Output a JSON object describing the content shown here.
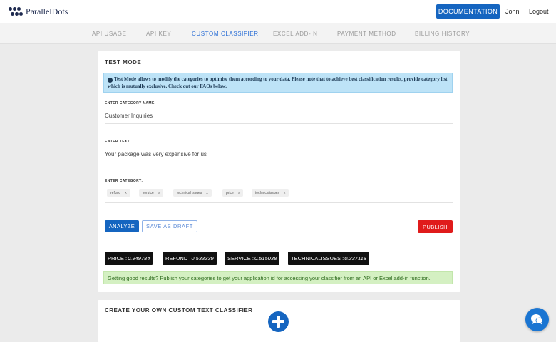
{
  "header": {
    "brand": "ParallelDots",
    "documentation_label": "DOCUMENTATION",
    "user": "John",
    "logout_label": "Logout"
  },
  "tabs": [
    {
      "label": "API USAGE",
      "active": false
    },
    {
      "label": "API KEY",
      "active": false
    },
    {
      "label": "CUSTOM CLASSIFIER",
      "active": true
    },
    {
      "label": "EXCEL ADD-IN",
      "active": false
    },
    {
      "label": "PAYMENT METHOD",
      "active": false
    },
    {
      "label": "BILLING HISTORY",
      "active": false
    }
  ],
  "test_mode": {
    "title": "TEST MODE",
    "info_text": "Test Mode allows to modify the categories to optimise them according to your data. Please note that to achieve best classification results, provide category list which is mutually exclusive. Check out our FAQs below.",
    "category_name_label": "ENTER CATEGORY NAME:",
    "category_name_value": "Customer Inquiries",
    "text_label": "ENTER TEXT:",
    "text_value": "Your package was very expensive for us",
    "category_label": "ENTER CATEGORY:",
    "categories": [
      {
        "label": "refund",
        "remove": "x"
      },
      {
        "label": "service",
        "remove": "x"
      },
      {
        "label": "technical issues",
        "remove": "x"
      },
      {
        "label": "price",
        "remove": "x"
      },
      {
        "label": "technicalissues",
        "remove": "x"
      }
    ],
    "analyze_label": "ANALYZE",
    "save_draft_label": "SAVE AS DRAFT",
    "publish_label": "PUBLISH",
    "results": [
      {
        "name": "PRICE :",
        "score": "0.949784"
      },
      {
        "name": "REFUND :",
        "score": "0.533339"
      },
      {
        "name": "SERVICE :",
        "score": "0.515038"
      },
      {
        "name": "TECHNICALISSUES :",
        "score": "0.337118"
      }
    ],
    "success_message": "Getting good results? Publish your categories to get your application id for accessing your classifier from an API or Excel add-in function."
  },
  "create_section": {
    "title": "CREATE YOUR OWN CUSTOM TEXT CLASSIFIER"
  },
  "colors": {
    "primary": "#1565c0",
    "publish": "#e01b1b",
    "info_bg": "#bde3f7",
    "success_bg": "#d4f0c2"
  },
  "icons": {
    "logo": "dots-logo-icon",
    "info": "info-circle-icon",
    "add": "plus-circle-icon",
    "chat": "chat-bubble-icon"
  }
}
